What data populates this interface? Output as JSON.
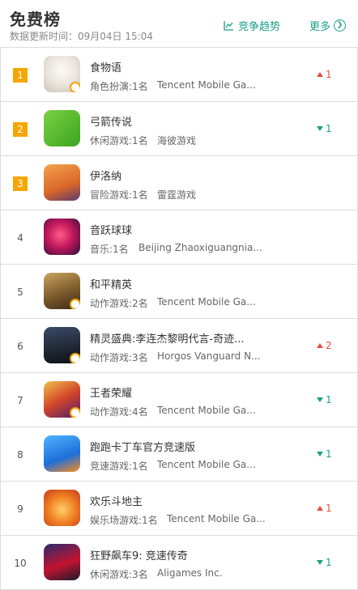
{
  "header": {
    "title": "免费榜",
    "updated": "数据更新时间：09月04日 15:04",
    "trend_label": "竞争趋势",
    "more_label": "更多"
  },
  "colors": {
    "accent": "#1aa089",
    "top_rank": "#f7a600",
    "up": "#e84c3d",
    "down": "#1aa089"
  },
  "apps": [
    {
      "rank": "1",
      "name": "食物语",
      "category": "角色扮演:1名",
      "developer": "Tencent Mobile Ga...",
      "change": "1",
      "direction": "up",
      "icon": "food-fantasy-icon"
    },
    {
      "rank": "2",
      "name": "弓箭传说",
      "category": "休闲游戏:1名",
      "developer": "海彼游戏",
      "change": "1",
      "direction": "down",
      "icon": "archero-icon"
    },
    {
      "rank": "3",
      "name": "伊洛纳",
      "category": "冒险游戏:1名",
      "developer": "雷霆游戏",
      "change": "",
      "direction": "none",
      "icon": "elona-icon"
    },
    {
      "rank": "4",
      "name": "音跃球球",
      "category": "音乐:1名",
      "developer": "Beijing Zhaoxiguangnia...",
      "change": "",
      "direction": "none",
      "icon": "music-ball-icon"
    },
    {
      "rank": "5",
      "name": "和平精英",
      "category": "动作游戏:2名",
      "developer": "Tencent Mobile Ga...",
      "change": "",
      "direction": "none",
      "icon": "peace-elite-icon"
    },
    {
      "rank": "6",
      "name": "精灵盛典:李连杰黎明代言-奇迹...",
      "category": "动作游戏:3名",
      "developer": "Horgos Vanguard N...",
      "change": "2",
      "direction": "up",
      "icon": "elf-ceremony-icon"
    },
    {
      "rank": "7",
      "name": "王者荣耀",
      "category": "动作游戏:4名",
      "developer": "Tencent Mobile Ga...",
      "change": "1",
      "direction": "down",
      "icon": "honor-of-kings-icon"
    },
    {
      "rank": "8",
      "name": "跑跑卡丁车官方竞速版",
      "category": "竞速游戏:1名",
      "developer": "Tencent Mobile Ga...",
      "change": "1",
      "direction": "down",
      "icon": "kartrider-icon"
    },
    {
      "rank": "9",
      "name": "欢乐斗地主",
      "category": "娱乐场游戏:1名",
      "developer": "Tencent Mobile Ga...",
      "change": "1",
      "direction": "up",
      "icon": "happy-landlord-icon"
    },
    {
      "rank": "10",
      "name": "狂野飙车9: 竞速传奇",
      "category": "休闲游戏:3名",
      "developer": "Aligames Inc.",
      "change": "1",
      "direction": "down",
      "icon": "asphalt9-icon"
    }
  ]
}
